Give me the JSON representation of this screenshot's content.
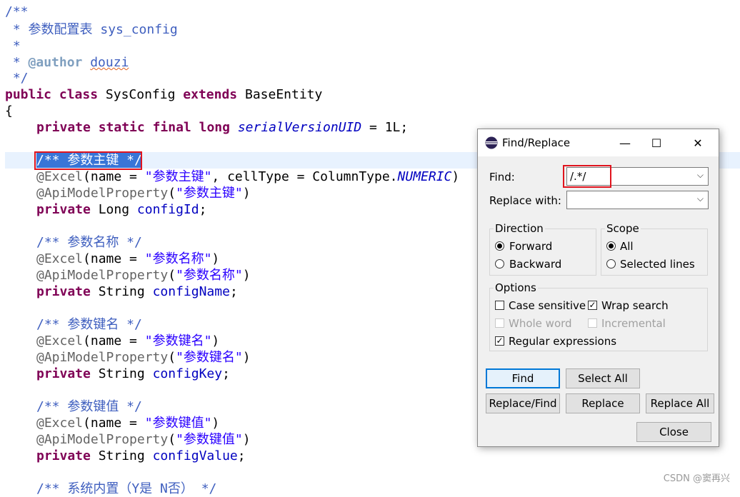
{
  "code": {
    "l1": "/**",
    "l2a": " * ",
    "l2b": "参数配置表",
    "l2c": " sys_config",
    "l3": " *",
    "l4a": " * ",
    "l4b": "@author",
    "l4c": " ",
    "l4d": "douzi",
    "l5": " */",
    "l6a": "public",
    "l6b": " ",
    "l6c": "class",
    "l6d": " SysConfig ",
    "l6e": "extends",
    "l6f": " BaseEntity",
    "l7": "{",
    "l8a": "private",
    "l8b": "static",
    "l8c": "final",
    "l8d": "long",
    "l8e": "serialVersionUID",
    "l8f": " = 1L;",
    "c1": "/** 参数主键 */",
    "e1a": "@Excel",
    "e1b": "(name = ",
    "e1c": "\"参数主键\"",
    "e1d": ", cellType = ColumnType.",
    "e1e": "NUMERIC",
    "e1f": ")",
    "a1a": "@ApiModelProperty",
    "a1b": "(",
    "a1c": "\"参数主键\"",
    "a1d": ")",
    "f1a": "private",
    "f1b": " Long ",
    "f1c": "configId",
    "f1d": ";",
    "c2": "/** 参数名称 */",
    "e2a": "@Excel",
    "e2b": "(name = ",
    "e2c": "\"参数名称\"",
    "e2d": ")",
    "a2a": "@ApiModelProperty",
    "a2b": "(",
    "a2c": "\"参数名称\"",
    "a2d": ")",
    "f2a": "private",
    "f2b": " String ",
    "f2c": "configName",
    "f2d": ";",
    "c3": "/** 参数键名 */",
    "e3a": "@Excel",
    "e3b": "(name = ",
    "e3c": "\"参数键名\"",
    "e3d": ")",
    "a3a": "@ApiModelProperty",
    "a3b": "(",
    "a3c": "\"参数键名\"",
    "a3d": ")",
    "f3a": "private",
    "f3b": " String ",
    "f3c": "configKey",
    "f3d": ";",
    "c4": "/** 参数键值 */",
    "e4a": "@Excel",
    "e4b": "(name = ",
    "e4c": "\"参数键值\"",
    "e4d": ")",
    "a4a": "@ApiModelProperty",
    "a4b": "(",
    "a4c": "\"参数键值\"",
    "a4d": ")",
    "f4a": "private",
    "f4b": " String ",
    "f4c": "configValue",
    "f4d": ";",
    "c5": "/** 系统内置（Y是 N否） */"
  },
  "dialog": {
    "title": "Find/Replace",
    "find_label": "Find:",
    "find_value": "/.*/",
    "replace_label": "Replace with:",
    "replace_value": "",
    "direction_title": "Direction",
    "forward": "Forward",
    "backward": "Backward",
    "scope_title": "Scope",
    "all": "All",
    "selected_lines": "Selected lines",
    "options_title": "Options",
    "case_sensitive": "Case sensitive",
    "wrap_search": "Wrap search",
    "whole_word": "Whole word",
    "incremental": "Incremental",
    "regex": "Regular expressions",
    "btn_find": "Find",
    "btn_select_all": "Select All",
    "btn_replace_find": "Replace/Find",
    "btn_replace": "Replace",
    "btn_replace_all": "Replace All",
    "btn_close": "Close",
    "minimize_glyph": "—",
    "maximize_glyph": "☐",
    "close_glyph": "✕",
    "check_glyph": "✓",
    "arrow_glyph": "⌵"
  },
  "watermark": "CSDN @窦再兴",
  "colors": {
    "keyword": "#7f0055",
    "comment": "#3f5fbf",
    "string": "#2a00ff",
    "field": "#0000c0",
    "selection": "#3875d7",
    "highlight_box": "#e0141e"
  }
}
